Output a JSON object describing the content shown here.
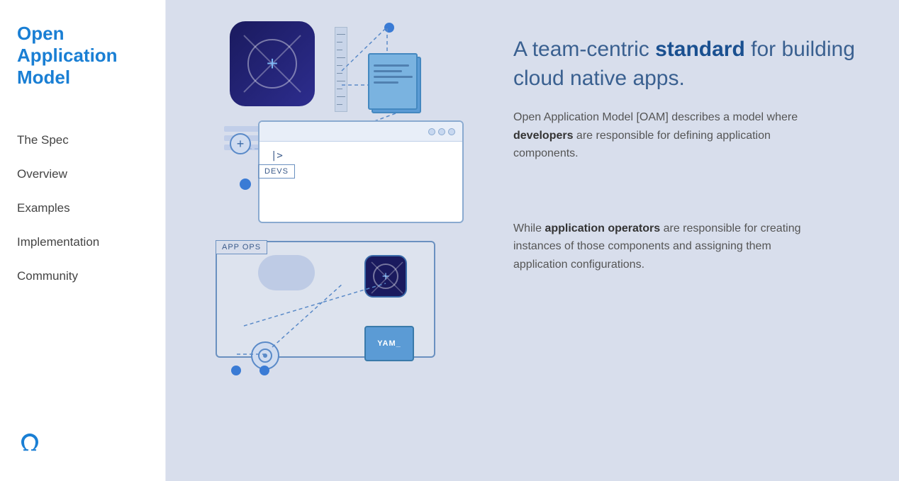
{
  "logo": {
    "line1": "Open",
    "line2": "Application",
    "line3": "Model"
  },
  "nav": {
    "items": [
      {
        "id": "the-spec",
        "label": "The Spec"
      },
      {
        "id": "overview",
        "label": "Overview"
      },
      {
        "id": "examples",
        "label": "Examples"
      },
      {
        "id": "implementation",
        "label": "Implementation"
      },
      {
        "id": "community",
        "label": "Community"
      }
    ]
  },
  "hero": {
    "headline_plain": "A team-centric ",
    "headline_bold": "standard",
    "headline_rest": " for building cloud native apps.",
    "body_paragraph1_pre": "Open Application Model [OAM] describes a model where ",
    "body_paragraph1_bold": "developers",
    "body_paragraph1_post": " are responsible for defining application components.",
    "body_paragraph2_pre": "While ",
    "body_paragraph2_bold": "application operators",
    "body_paragraph2_post": " are responsible for creating instances of those components and assigning them application configurations."
  },
  "labels": {
    "devs": "DEVS",
    "app_ops": "APP OPS",
    "yam": "YAM_",
    "terminal_cursor": "|>"
  }
}
